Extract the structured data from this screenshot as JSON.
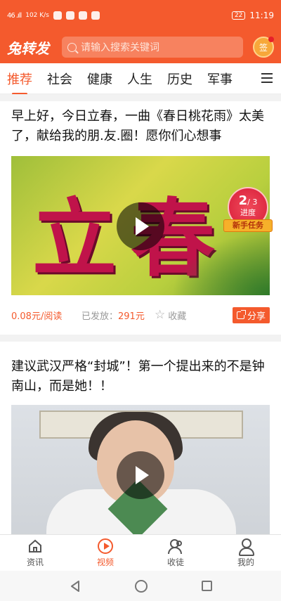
{
  "status_bar": {
    "signal": "46  .ıll",
    "speed": "102 K/s",
    "battery": "22",
    "time": "11:19"
  },
  "header": {
    "logo": "兔转发",
    "search_placeholder": "请输入搜索关键词",
    "signin_label": "签"
  },
  "tabs": [
    "推荐",
    "社会",
    "健康",
    "人生",
    "历史",
    "军事"
  ],
  "articles": [
    {
      "title": "早上好，今日立春，一曲《春日桃花雨》太美了，献给我的朋.友.圈！愿你们心想事",
      "thumb_text": "立春",
      "rate": "0.08元/阅读",
      "sent_label": "已发放：",
      "sent_value": "291元",
      "fav_label": "收藏",
      "share_label": "分享"
    },
    {
      "title": "建议武汉严格“封城”！第一个提出来的不是钟南山，而是她！！"
    }
  ],
  "progress_badge": {
    "current": "2",
    "total": "/ 3",
    "label": "进度",
    "ribbon": "新手任务"
  },
  "bottom_nav": [
    {
      "label": "资讯"
    },
    {
      "label": "视频"
    },
    {
      "label": "收徒"
    },
    {
      "label": "我的"
    }
  ]
}
